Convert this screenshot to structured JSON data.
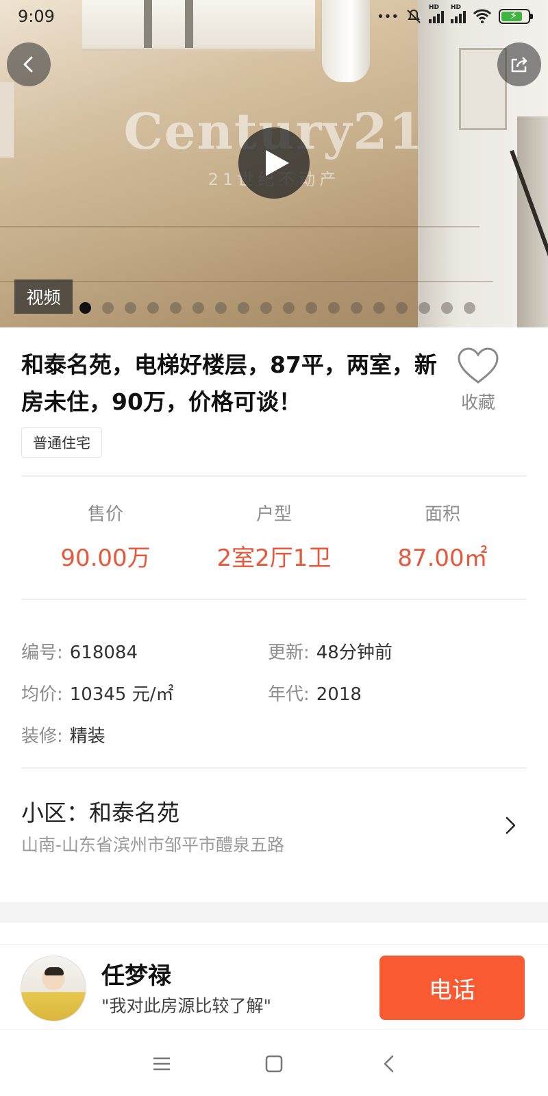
{
  "status_bar": {
    "time": "9:09",
    "signal_1_label": "HD",
    "signal_2_label": "HD",
    "battery_fill": 0.8,
    "colors": {
      "battery": "#3fb540"
    }
  },
  "gallery": {
    "watermark_brand": "Century21",
    "watermark_sub": "21世纪不动产",
    "video_tag": "视频",
    "total_images": 18,
    "active_index": 0
  },
  "listing": {
    "title": "和泰名苑，电梯好楼层，87平，两室，新房未住，90万，价格可谈！",
    "tag": "普通住宅",
    "favorite_label": "收藏"
  },
  "stats": [
    {
      "label": "售价",
      "value": "90.00万"
    },
    {
      "label": "户型",
      "value": "2室2厅1卫"
    },
    {
      "label": "面积",
      "value": "87.00㎡"
    }
  ],
  "details": {
    "id_label": "编号:",
    "id_value": "618084",
    "updated_label": "更新:",
    "updated_value": "48分钟前",
    "avg_price_label": "均价:",
    "avg_price_value": "10345 元/㎡",
    "year_label": "年代:",
    "year_value": "2018",
    "decoration_label": "装修:",
    "decoration_value": "精装"
  },
  "community": {
    "title": "小区：和泰名苑",
    "address": "山南-山东省滨州市邹平市醴泉五路"
  },
  "agent": {
    "name": "任梦禄",
    "note": "\"我对此房源比较了解\"",
    "call_label": "电话"
  },
  "colors": {
    "accent": "#e8573a",
    "call_button": "#f85a32"
  }
}
